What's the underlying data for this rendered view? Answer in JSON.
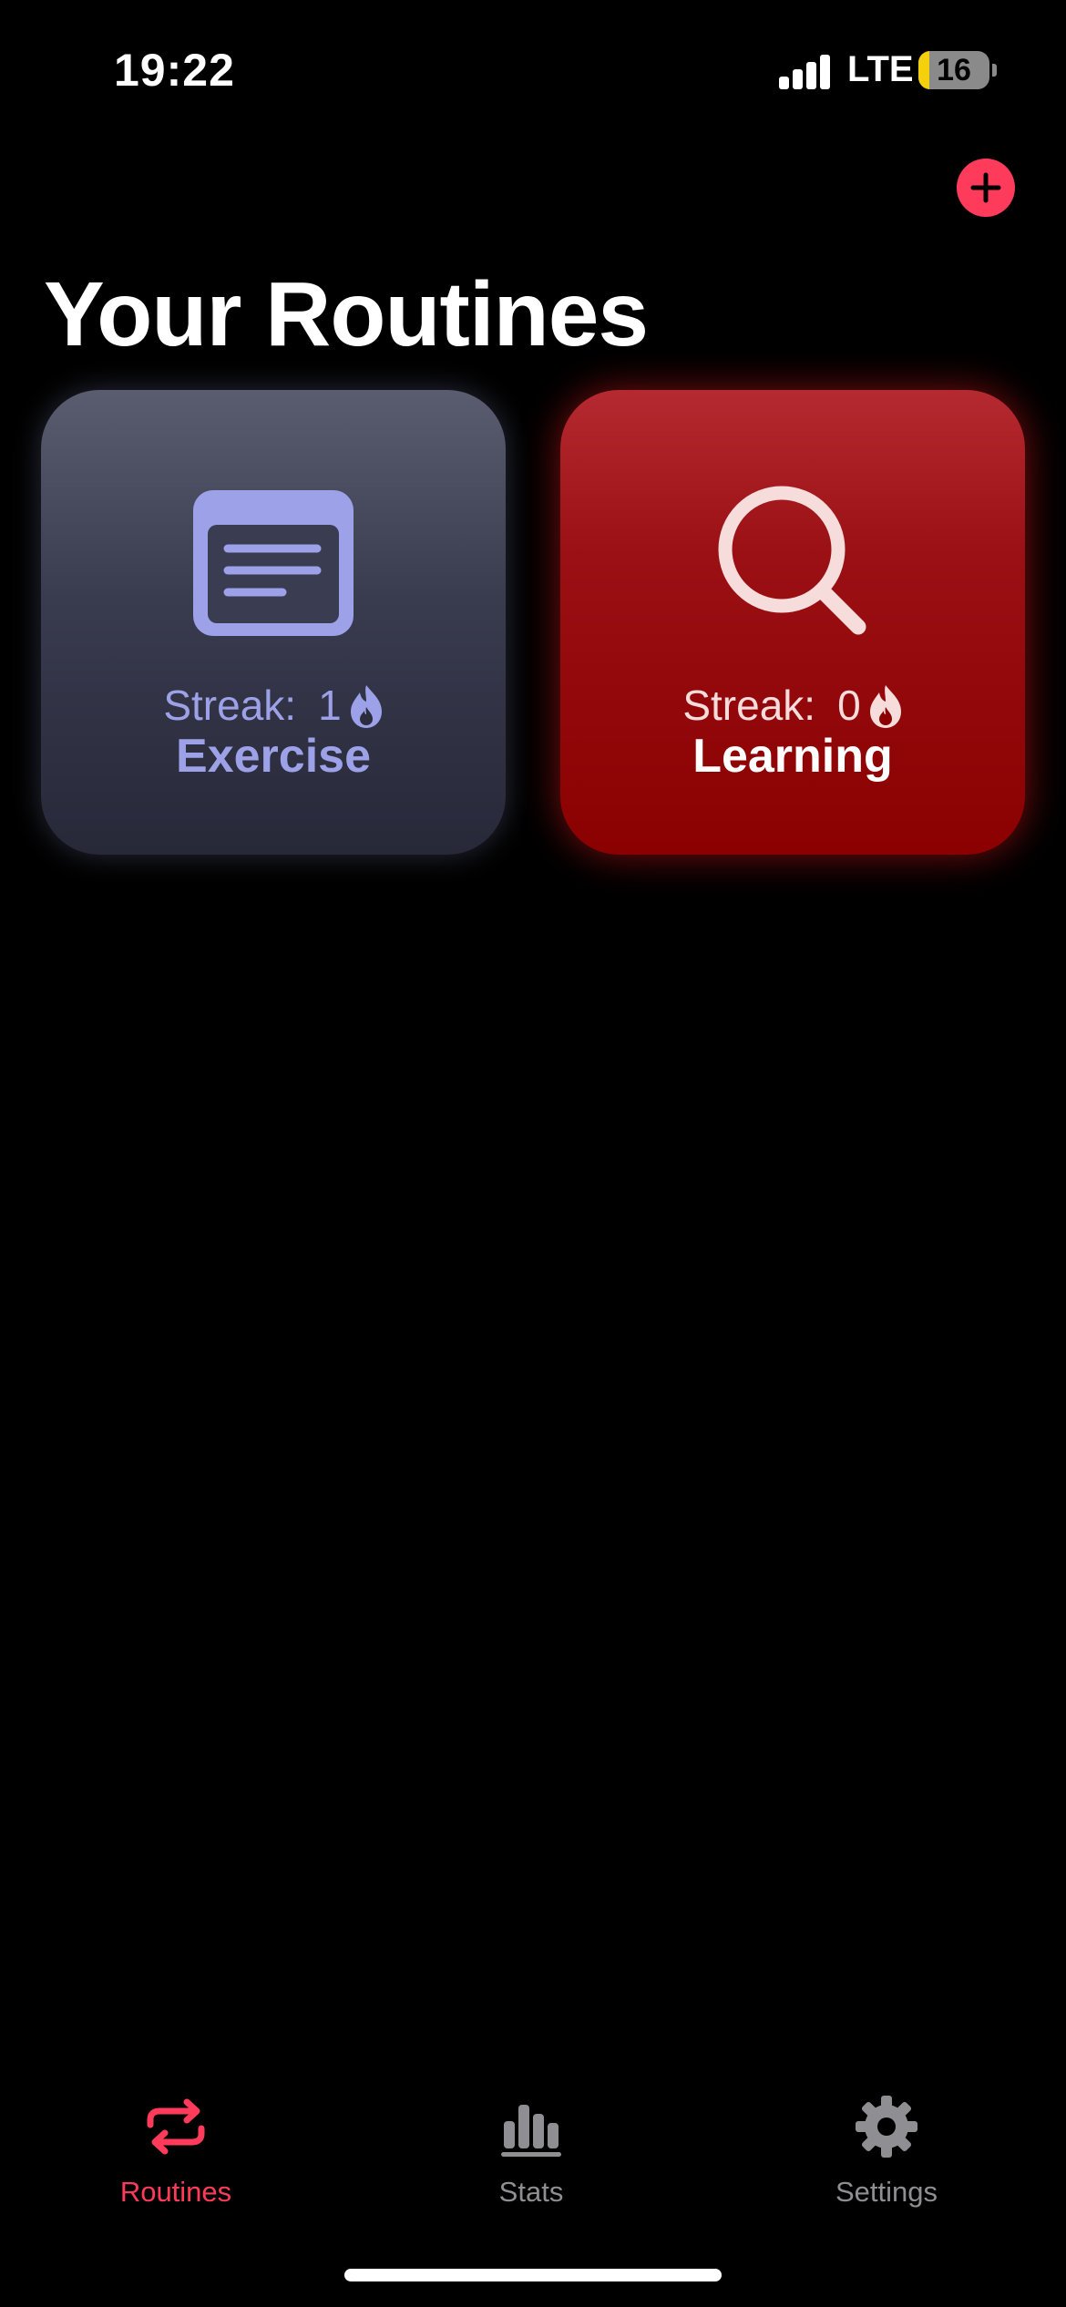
{
  "status_bar": {
    "time": "19:22",
    "network": "LTE",
    "battery_level": "16",
    "battery_fraction": 0.16,
    "signal_bars": 4
  },
  "header": {
    "add_icon": "plus-circle-icon",
    "title": "Your Routines"
  },
  "routines": [
    {
      "name": "Exercise",
      "streak_label": "Streak:",
      "streak_value": "1",
      "icon": "list-card-icon",
      "accent_color": "#9da2e8"
    },
    {
      "name": "Learning",
      "streak_label": "Streak:",
      "streak_value": "0",
      "icon": "magnifying-glass-icon",
      "accent_color": "#f7dcdc"
    }
  ],
  "tab_bar": {
    "tabs": [
      {
        "label": "Routines",
        "icon": "repeat-icon",
        "active": true
      },
      {
        "label": "Stats",
        "icon": "bar-chart-icon",
        "active": false
      },
      {
        "label": "Settings",
        "icon": "gear-icon",
        "active": false
      }
    ]
  },
  "colors": {
    "accent": "#ff3b5c",
    "inactive": "#8e8e93",
    "background": "#000000"
  }
}
